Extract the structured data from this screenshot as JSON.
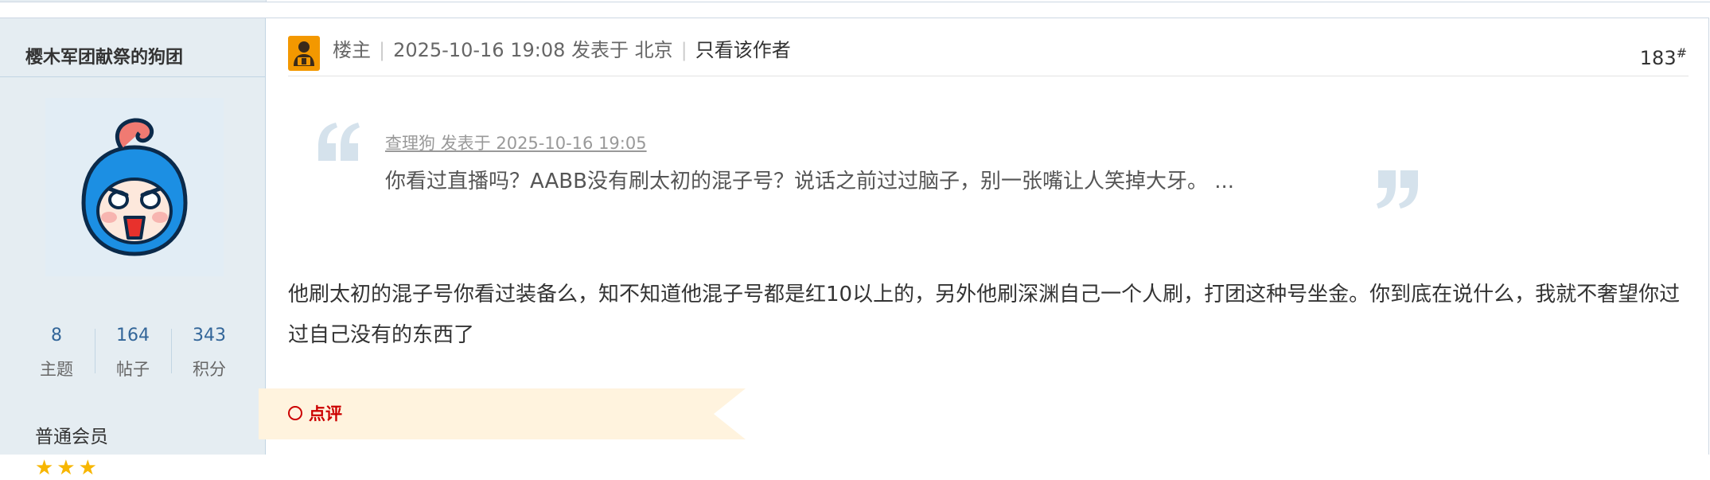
{
  "user": {
    "name": "樱木军团献祭的狗团",
    "avatar": "avatar-image",
    "stats": [
      {
        "value": "8",
        "label": "主题"
      },
      {
        "value": "164",
        "label": "帖子"
      },
      {
        "value": "343",
        "label": "积分"
      }
    ],
    "group": "普通会员",
    "stars": "★★★",
    "star_color": "#f7b600"
  },
  "post": {
    "owner_label": "楼主",
    "meta": "2025-10-16 19:08 发表于 北京",
    "author_only": "只看该作者",
    "floor": "183",
    "floor_suffix": "#",
    "quote": {
      "meta": "查理狗 发表于 2025-10-16 19:05",
      "text": "你看过直播吗？AABB没有刷太初的混子号？说话之前过过脑子，别一张嘴让人笑掉大牙。 ..."
    },
    "body": "他刷太初的混子号你看过装备么，知不知道他混子号都是红10以上的，另外他刷深渊自己一个人刷，打团这种号坐金。你到底在说什么，我就不奢望你过过自己没有的东西了",
    "comment_label": "点评"
  },
  "colors": {
    "sidebar_bg": "#e5edf2",
    "link_blue": "#336699",
    "owner_badge": "#f39800",
    "comment_red": "#cc0000",
    "comment_bar_bg": "#fff3de"
  }
}
